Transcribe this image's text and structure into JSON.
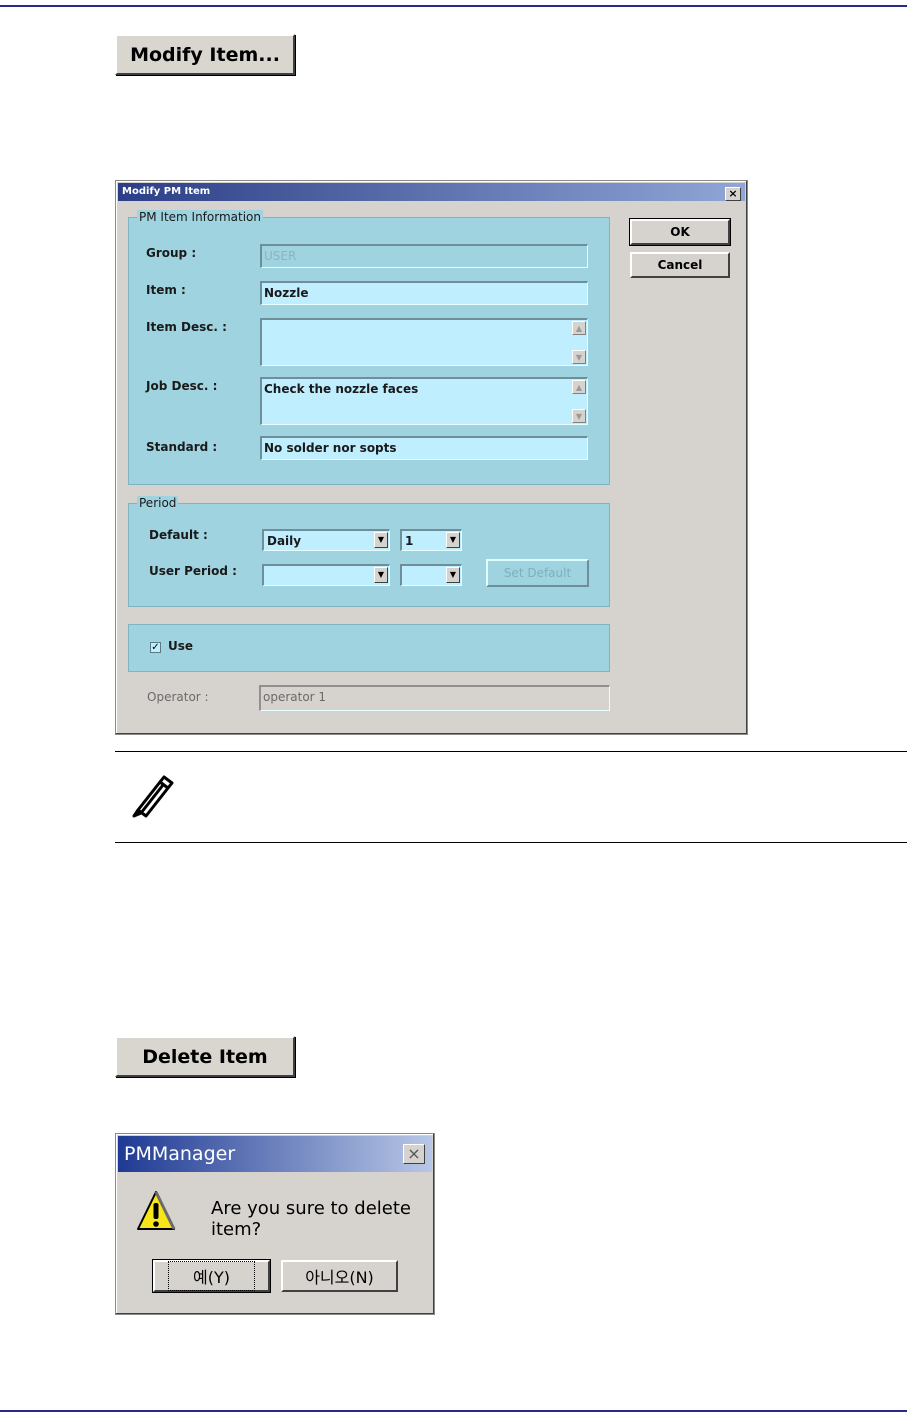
{
  "buttons": {
    "modify_item": "Modify Item...",
    "delete_item": "Delete Item"
  },
  "modify_dialog": {
    "title": "Modify PM Item",
    "close": "×",
    "ok": "OK",
    "cancel": "Cancel",
    "info_group": "PM Item Information",
    "group_label": "Group :",
    "group_value": "USER",
    "item_label": "Item :",
    "item_value": "Nozzle",
    "item_desc_label": "Item Desc. :",
    "item_desc_value": "",
    "job_desc_label": "Job Desc. :",
    "job_desc_value": "Check the nozzle faces",
    "standard_label": "Standard :",
    "standard_value": "No solder nor sopts",
    "period_group": "Period",
    "default_label": "Default :",
    "default_period": "Daily",
    "default_count": "1",
    "user_period_label": "User Period :",
    "user_period": "",
    "user_count": "",
    "set_default": "Set Default",
    "use_label": "Use",
    "use_checked": true,
    "operator_label": "Operator :",
    "operator_value": "operator 1"
  },
  "note": {
    "icon": "pencil-icon"
  },
  "message_box": {
    "title": "PMManager",
    "close": "×",
    "icon": "warning-icon",
    "text": "Are you sure to delete item?",
    "yes": "예(Y)",
    "no": "아니오(N)"
  }
}
